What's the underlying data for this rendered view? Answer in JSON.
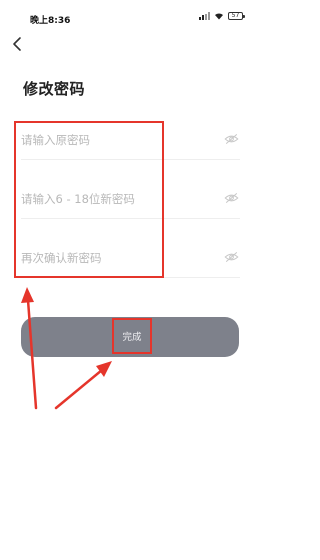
{
  "status_bar": {
    "time": "晚上8:36",
    "battery": "57"
  },
  "title": "修改密码",
  "fields": [
    {
      "placeholder": "请输入原密码",
      "value": ""
    },
    {
      "placeholder": "请输入6 - 18位新密码",
      "value": ""
    },
    {
      "placeholder": "再次确认新密码",
      "value": ""
    }
  ],
  "submit_label": "完成",
  "colors": {
    "button": "#7e818b",
    "annotation": "#e5352b",
    "placeholder": "#b8b8b8"
  }
}
